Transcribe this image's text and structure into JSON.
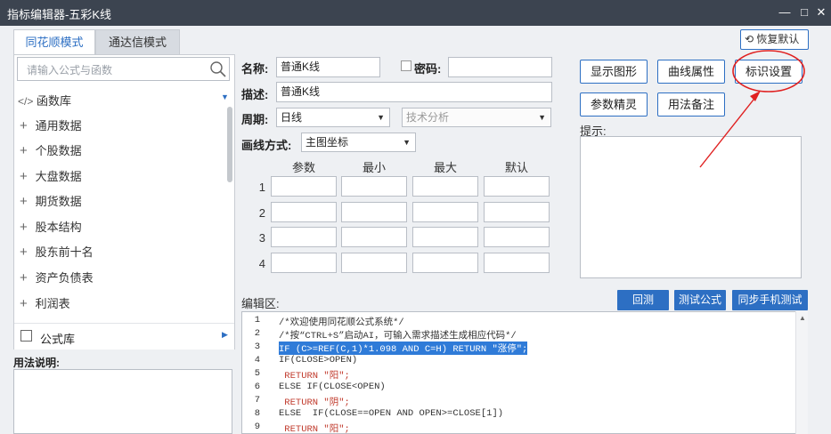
{
  "window": {
    "title": "指标编辑器-五彩K线",
    "min_glyph": "—",
    "max_glyph": "□",
    "close_glyph": "✕"
  },
  "tabs": [
    "同花顺模式",
    "通达信模式"
  ],
  "restore_button": "恢复默认",
  "search": {
    "placeholder": "请输入公式与函数"
  },
  "left_tree": {
    "root": "函数库",
    "items": [
      "通用数据",
      "个股数据",
      "大盘数据",
      "期货数据",
      "股本结构",
      "股东前十名",
      "资产负债表",
      "利润表"
    ],
    "footer": "公式库"
  },
  "usage_label": "用法说明:",
  "form": {
    "name_label": "名称:",
    "name_value": "普通K线",
    "password_label": "密码:",
    "password_value": "",
    "desc_label": "描述:",
    "desc_value": "普通K线",
    "period_label": "周期:",
    "period_value": "日线",
    "category_placeholder": "技术分析",
    "draw_label": "画线方式:",
    "draw_value": "主图坐标"
  },
  "param_table": {
    "headers": [
      "参数",
      "最小",
      "最大",
      "默认"
    ],
    "rows": [
      "1",
      "2",
      "3",
      "4"
    ]
  },
  "right_buttons": [
    "显示图形",
    "曲线属性",
    "标识设置",
    "参数精灵",
    "用法备注"
  ],
  "hint_label": "提示:",
  "editor_label": "编辑区:",
  "editor_buttons": [
    "回测",
    "测试公式",
    "同步手机测试"
  ],
  "code_lines": [
    {
      "n": "1",
      "text": "/*欢迎使用同花顺公式系统*/"
    },
    {
      "n": "2",
      "text": "/*按“CTRL+S”启动AI，可输入需求描述生成相应代码*/"
    },
    {
      "n": "3",
      "text": "IF (C>=REF(C,1)*1.098 AND C=H) RETURN \"涨停\";"
    },
    {
      "n": "4",
      "text": "IF(CLOSE>OPEN)"
    },
    {
      "n": "5",
      "text": " RETURN \"阳\";"
    },
    {
      "n": "6",
      "text": "ELSE IF(CLOSE<OPEN)"
    },
    {
      "n": "7",
      "text": " RETURN \"阴\";"
    },
    {
      "n": "8",
      "text": "ELSE  IF(CLOSE==OPEN AND OPEN>=CLOSE[1])"
    },
    {
      "n": "9",
      "text": " RETURN \"阳\";"
    }
  ],
  "colors": {
    "accent": "#2d6fc3",
    "annotation": "#e02020",
    "selection": "#2f7bd8"
  }
}
